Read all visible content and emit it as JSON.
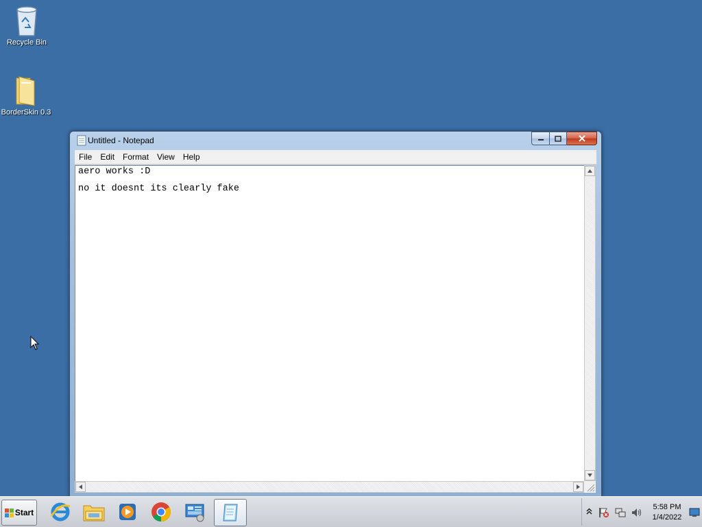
{
  "desktop": {
    "icons": [
      {
        "label": "Recycle Bin",
        "icon": "recycle-bin-icon"
      },
      {
        "label": "BorderSkin 0.3",
        "icon": "folder-icon"
      }
    ]
  },
  "notepad": {
    "title": "Untitled - Notepad",
    "menu": [
      "File",
      "Edit",
      "Format",
      "View",
      "Help"
    ],
    "lines": [
      "aero works :D",
      "no it doesnt its clearly fake"
    ]
  },
  "taskbar": {
    "start_label": "Start",
    "apps": [
      {
        "name": "internet-explorer-icon"
      },
      {
        "name": "file-explorer-icon"
      },
      {
        "name": "media-player-icon"
      },
      {
        "name": "chrome-icon"
      },
      {
        "name": "control-panel-icon"
      },
      {
        "name": "notepad-icon",
        "active": true
      }
    ],
    "clock": {
      "time": "5:58 PM",
      "date": "1/4/2022"
    }
  },
  "colors": {
    "desktop": "#3a6ea5",
    "close_button": "#c2391d"
  }
}
